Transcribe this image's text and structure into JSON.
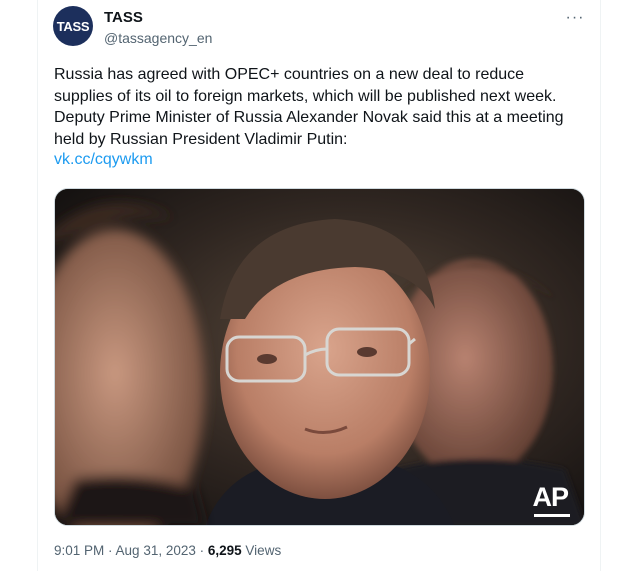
{
  "author": {
    "avatar_text": "TASS",
    "name": "TASS",
    "handle": "@tassagency_en"
  },
  "more_label": "···",
  "tweet": {
    "text": "Russia has agreed with OPEC+ countries on a new deal to reduce\nsupplies of its oil to foreign markets, which will be published next week.\nDeputy Prime Minister of Russia Alexander Novak said this at a meeting\nheld by Russian President Vladimir Putin:",
    "link": "vk.cc/cqywkm"
  },
  "media": {
    "watermark": "AP"
  },
  "meta": {
    "time": "9:01 PM",
    "separator": " · ",
    "date": "Aug 31, 2023",
    "views_count": "6,295",
    "views_label": " Views"
  },
  "colors": {
    "avatar_bg": "#1c2f5c",
    "link": "#1d9bf0",
    "secondary_text": "#536471",
    "primary_text": "#0f1419"
  }
}
